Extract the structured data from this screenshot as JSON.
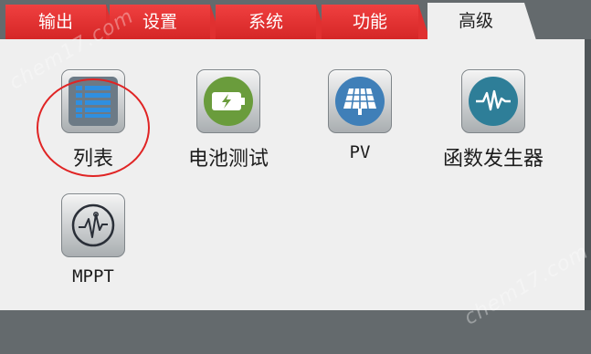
{
  "tabs": [
    {
      "label": "输出",
      "active": false
    },
    {
      "label": "设置",
      "active": false
    },
    {
      "label": "系统",
      "active": false
    },
    {
      "label": "功能",
      "active": false
    },
    {
      "label": "高级",
      "active": true
    }
  ],
  "items": [
    {
      "label": "列表",
      "icon": "list-icon"
    },
    {
      "label": "电池测试",
      "icon": "battery-icon"
    },
    {
      "label": "PV",
      "icon": "solar-panel-icon"
    },
    {
      "label": "函数发生器",
      "icon": "waveform-icon"
    },
    {
      "label": "MPPT",
      "icon": "mppt-curve-icon"
    }
  ],
  "watermark": "chem17.com",
  "colors": {
    "tab_red": "#e03030",
    "panel_bg": "#efefef",
    "frame_bg": "#646a6d",
    "highlight_circle": "#e02424"
  }
}
